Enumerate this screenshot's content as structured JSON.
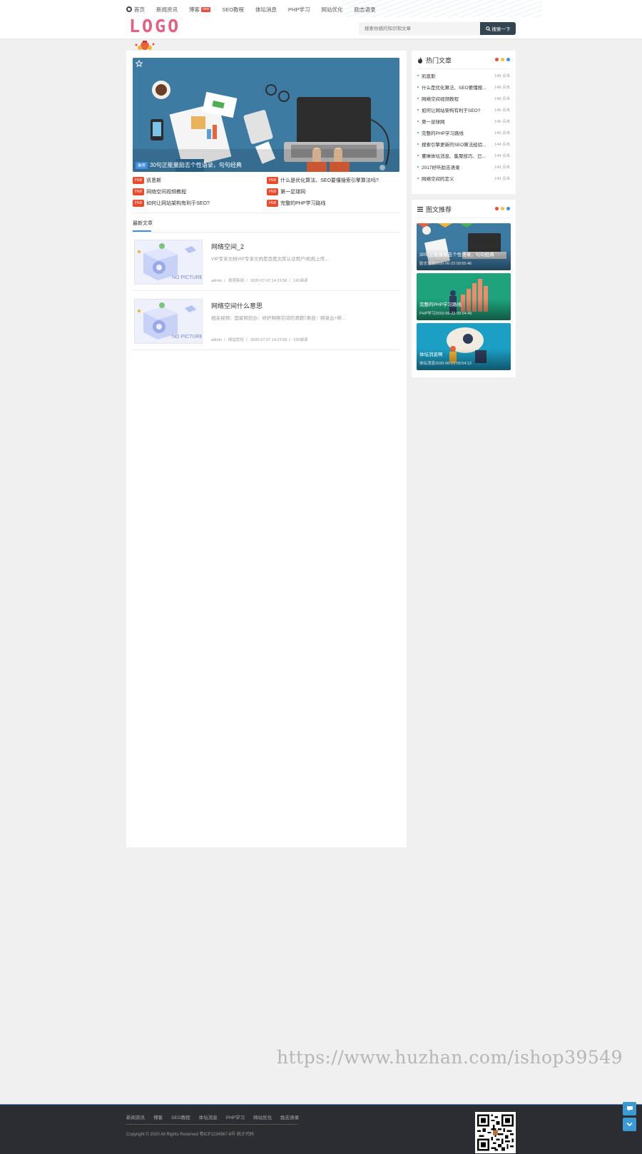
{
  "nav": {
    "home": "首页",
    "items": [
      "新闻资讯",
      "博客",
      "SEO教程",
      "体坛消息",
      "PHP学习",
      "网站优化",
      "励志语录"
    ],
    "new_badge": "new"
  },
  "logo": "LOGO",
  "search": {
    "placeholder": "搜索你感的知识和文章",
    "button": "搜索一下"
  },
  "banner": {
    "tag": "推荐",
    "caption": "30句正能量励志个性语录，句句经典"
  },
  "hot": {
    "tag": "Hot",
    "items": [
      "凯恩斯",
      "什么是优化算法、SEO要懂搜索引擎算法吗?",
      "网络空间视频教程",
      "第一足球网",
      "如何让网站架构有利于SEO?",
      "完整的PHP学习路线"
    ]
  },
  "latest": {
    "title": "最新文章",
    "articles": [
      {
        "title": "网络空间_2",
        "desc": "VIP专享文档VIP专享文档是百度文库认证用户/机构上传...",
        "author": "admin",
        "category": "体育新闻",
        "date": "2020-07-07 14:23:58",
        "views": "141阅读"
      },
      {
        "title": "网络空间什么意思",
        "desc": "相关视频：国家网信办：修护网络空间的清朗7来自：网易云+帮...",
        "author": "admin",
        "category": "网站优化",
        "date": "2020-07-07 14:23:58",
        "views": "100阅读"
      }
    ]
  },
  "hot_articles": {
    "title": "热门文章",
    "items": [
      {
        "title": "凯恩斯",
        "count": "149 点击"
      },
      {
        "title": "什么是优化算法、SEO要懂搜...",
        "count": "148 点击"
      },
      {
        "title": "网络空间视频教程",
        "count": "148 点击"
      },
      {
        "title": "如何让网站架构有利于SEO?",
        "count": "146 点击"
      },
      {
        "title": "第一足球网",
        "count": "146 点击"
      },
      {
        "title": "完整的PHP学习路线",
        "count": "145 点击"
      },
      {
        "title": "搜索引擎更新的SEO算法经验...",
        "count": "144 点击"
      },
      {
        "title": "董琳体坛消息、集聚技巧、已...",
        "count": "144 点击"
      },
      {
        "title": "2017好听励志语录",
        "count": "143 点击"
      },
      {
        "title": "网络空间的定义",
        "count": "143 点击"
      }
    ]
  },
  "recommend": {
    "title": "图文推荐",
    "items": [
      {
        "title": "30句正能量励志个性语录，句句经典",
        "meta": "励志语录2020-06-23 09:55:46",
        "color": "#3d7ba3"
      },
      {
        "title": "完整的PHP学习路线",
        "meta": "PHP学习2020-06-23 09:54:46",
        "color": "#1ea37c"
      },
      {
        "title": "体坛消息啊",
        "meta": "体坛消息2020-06-23 09:54:12",
        "color": "#1b9fc5"
      }
    ]
  },
  "dots_colors": [
    "#e84e40",
    "#f3c136",
    "#3f8fe0"
  ],
  "watermark": "https://www.huzhan.com/ishop39549",
  "footer": {
    "links": [
      "新闻资讯",
      "博客",
      "SEO教程",
      "体坛消息",
      "PHP学习",
      "网站优化",
      "励志语录"
    ],
    "copyright": "Copyright © 2020 All Rights Reserved 粤ICP1234567-8号 统计代码"
  }
}
